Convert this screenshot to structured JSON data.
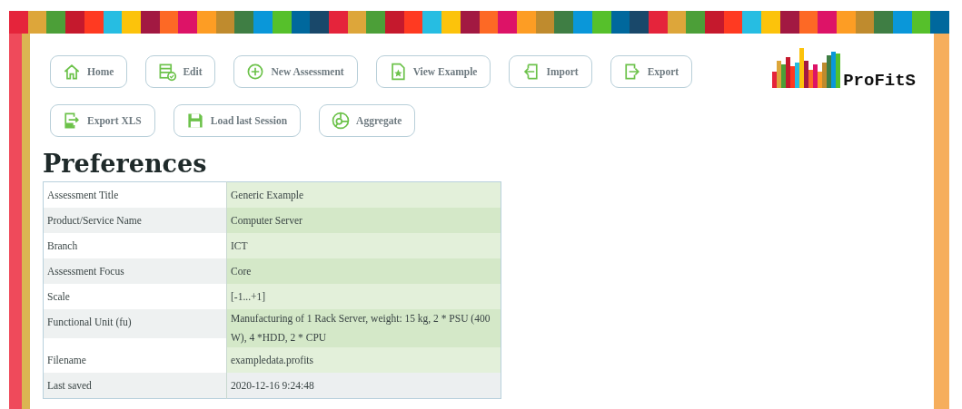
{
  "toolbar": {
    "buttons": [
      {
        "label": "Home"
      },
      {
        "label": "Edit"
      },
      {
        "label": "New Assessment"
      },
      {
        "label": "View Example"
      },
      {
        "label": "Import"
      },
      {
        "label": "Export"
      },
      {
        "label": "Export XLS"
      },
      {
        "label": "Load last Session"
      },
      {
        "label": "Aggregate"
      }
    ]
  },
  "logo": {
    "text": "ProFitS"
  },
  "heading": "Preferences",
  "table": {
    "rows": [
      {
        "label": "Assessment Title",
        "value": "Generic Example",
        "selected": false
      },
      {
        "label": "Product/Service Name",
        "value": "Computer Server",
        "selected": false
      },
      {
        "label": "Branch",
        "value": "ICT",
        "selected": false
      },
      {
        "label": "Assessment Focus",
        "value": "Core",
        "selected": false
      },
      {
        "label": "Scale",
        "value": "[-1...+1]",
        "selected": false
      },
      {
        "label": "Functional Unit (fu)",
        "value": "Manufacturing of 1 Rack Server, weight: 15 kg, 2 * PSU (400 W), 4 *HDD, 2 * CPU",
        "selected": false
      },
      {
        "label": "Filename",
        "value": "exampledata.profits",
        "selected": false
      },
      {
        "label": "Last saved",
        "value": "2020-12-16 9:24:48",
        "selected": true
      }
    ]
  }
}
